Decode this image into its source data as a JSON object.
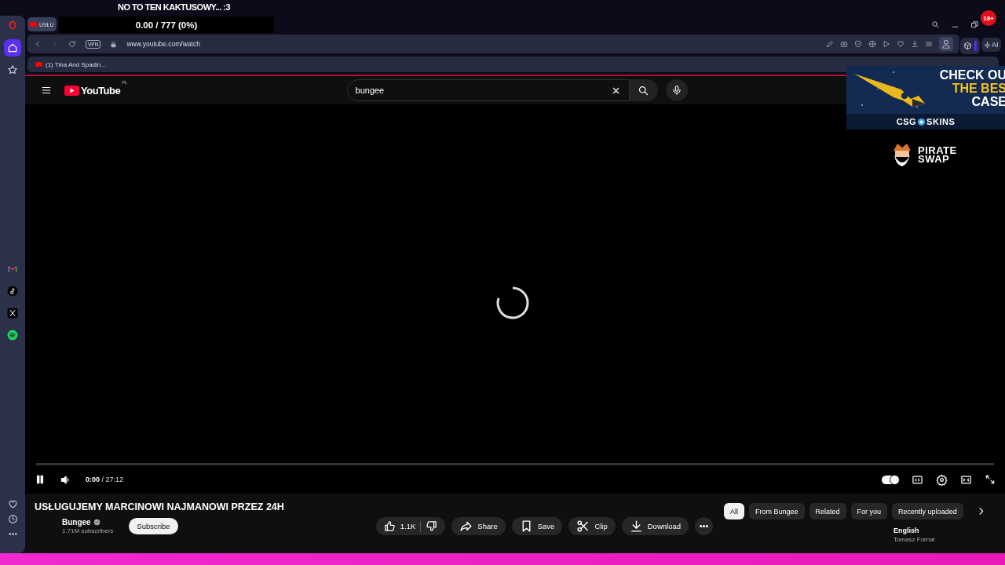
{
  "stream_overlay": {
    "caption": "NO TO TEN KAKTUSOWY... :3",
    "counter": "0.00 / 777 (0%)",
    "age_badge": "18+",
    "ad": {
      "lines": [
        "CHECK OU",
        "THE BES",
        "CASE"
      ],
      "brand_left": "CSG",
      "brand_right": "SKINS"
    },
    "sponsor": {
      "lines": [
        "PIRATE",
        "SWAP"
      ]
    }
  },
  "browser": {
    "tab": {
      "title": "USŁU"
    },
    "vpn": "VPN",
    "address": "www.youtube.com/watch",
    "ai_label": "AI",
    "bookmark": "(1) Tina And Spadin...",
    "sidebar": [
      {
        "kind": "home",
        "selected": true
      },
      {
        "kind": "star",
        "selected": false
      },
      {
        "kind": "gmail",
        "selected": false
      },
      {
        "kind": "tiktok",
        "selected": false
      },
      {
        "kind": "x",
        "selected": false
      },
      {
        "kind": "spotify",
        "selected": false
      }
    ]
  },
  "youtube": {
    "logo": "YouTube",
    "region": "PL",
    "search": "bungee",
    "player": {
      "playing": true,
      "time_current": "0:00",
      "time_total": "/ 27:12",
      "autoplay": true
    },
    "video": {
      "title": "USŁUGUJEMY MARCINOWI NAJMANOWI PRZEZ 24H",
      "channel": "Bungee",
      "verified": true,
      "subscribers": "1.71M subscribers",
      "subscribe": "Subscribe",
      "likes": "1.1K",
      "actions": [
        {
          "kind": "share",
          "label": "Share"
        },
        {
          "kind": "save",
          "label": "Save"
        },
        {
          "kind": "clip",
          "label": "Clip"
        },
        {
          "kind": "download",
          "label": "Download"
        }
      ]
    },
    "chips": [
      {
        "label": "All",
        "selected": true
      },
      {
        "label": "From Bungee",
        "selected": false
      },
      {
        "label": "Related",
        "selected": false
      },
      {
        "label": "For you",
        "selected": false
      },
      {
        "label": "Recently uploaded",
        "selected": false
      }
    ],
    "side_item": {
      "title": "English",
      "subtitle": "Tomasz Fornal"
    }
  }
}
